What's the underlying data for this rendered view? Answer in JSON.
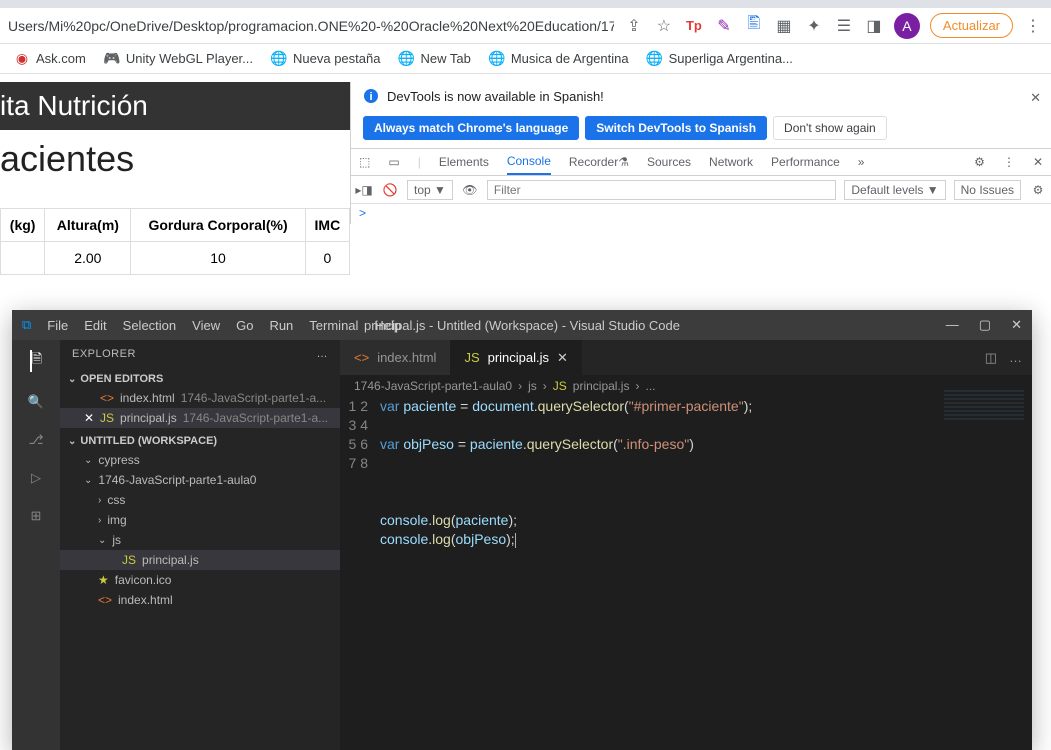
{
  "browser": {
    "url": "Users/Mi%20pc/OneDrive/Desktop/programacion.ONE%20-%20Oracle%20Next%20Education/174...",
    "avatar_letter": "A",
    "update_label": "Actualizar"
  },
  "bookmarks": [
    {
      "label": "Ask.com"
    },
    {
      "label": "Unity WebGL Player..."
    },
    {
      "label": "Nueva pestaña"
    },
    {
      "label": "New Tab"
    },
    {
      "label": "Musica de Argentina"
    },
    {
      "label": "Superliga Argentina..."
    }
  ],
  "page": {
    "title_frag": "ita Nutrición",
    "subtitle_frag": "acientes",
    "table": {
      "headers": [
        "(kg)",
        "Altura(m)",
        "Gordura Corporal(%)",
        "IMC"
      ],
      "row": [
        "",
        "2.00",
        "10",
        "0"
      ]
    }
  },
  "devtools": {
    "info_msg": "DevTools is now available in Spanish!",
    "btn_always": "Always match Chrome's language",
    "btn_switch": "Switch DevTools to Spanish",
    "btn_dont": "Don't show again",
    "tabs": [
      "Elements",
      "Console",
      "Recorder",
      "Sources",
      "Network",
      "Performance"
    ],
    "active_tab": "Console",
    "filter": {
      "top_label": "top ▼",
      "placeholder": "Filter",
      "levels": "Default levels ▼",
      "issues": "No Issues"
    },
    "console_prompt": ">"
  },
  "vscode": {
    "menu": [
      "File",
      "Edit",
      "Selection",
      "View",
      "Go",
      "Run",
      "Terminal",
      "Help"
    ],
    "title": "principal.js - Untitled (Workspace) - Visual Studio Code",
    "explorer_label": "EXPLORER",
    "open_editors_label": "OPEN EDITORS",
    "open_editors": [
      {
        "name": "index.html",
        "hint": "1746-JavaScript-parte1-a...",
        "dirty": false,
        "icon": "html"
      },
      {
        "name": "principal.js",
        "hint": "1746-JavaScript-parte1-a...",
        "dirty": true,
        "icon": "js",
        "selected": true
      }
    ],
    "workspace_label": "UNTITLED (WORKSPACE)",
    "tree": {
      "cypress": "cypress",
      "projectFolder": "1746-JavaScript-parte1-aula0",
      "css": "css",
      "img": "img",
      "js": "js",
      "principal": "principal.js",
      "favicon": "favicon.ico",
      "indexhtml": "index.html"
    },
    "editor_tabs": [
      {
        "name": "index.html",
        "icon": "html"
      },
      {
        "name": "principal.js",
        "icon": "js",
        "active": true
      }
    ],
    "breadcrumb": [
      "1746-JavaScript-parte1-aula0",
      "js",
      "principal.js",
      "..."
    ],
    "code": {
      "l1": {
        "kw": "var",
        "var": "paciente",
        "eq": " = ",
        "obj": "document",
        "dot": ".",
        "fn": "querySelector",
        "op": "(",
        "str": "\"#primer-paciente\"",
        "cp": ");"
      },
      "l3": {
        "kw": "var",
        "var": "objPeso",
        "eq": " = ",
        "obj": "paciente",
        "dot": ".",
        "fn": "querySelector",
        "op": "(",
        "str": "\".info-peso\"",
        "cp": ")"
      },
      "l7": {
        "obj": "console",
        "dot": ".",
        "fn": "log",
        "op": "(",
        "arg": "paciente",
        "cp": ");"
      },
      "l8": {
        "obj": "console",
        "dot": ".",
        "fn": "log",
        "op": "(",
        "arg": "objPeso",
        "cp": ");"
      }
    }
  }
}
